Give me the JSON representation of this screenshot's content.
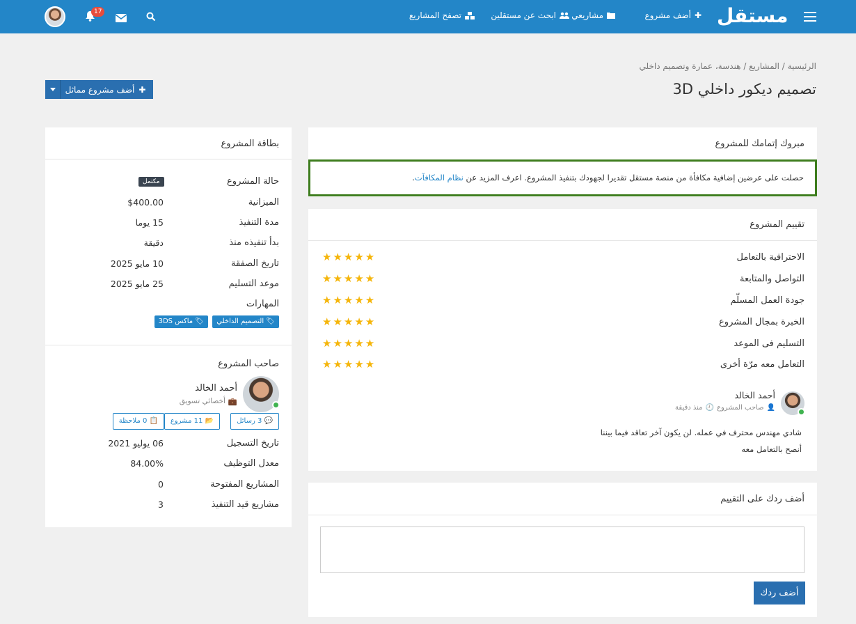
{
  "nav": {
    "logo": "مستقل",
    "items": [
      {
        "label": "أضف مشروع",
        "icon": "plus-icon"
      },
      {
        "label": "مشاريعي",
        "icon": "folder-icon"
      },
      {
        "label": "ابحث عن مستقلين",
        "icon": "users-icon"
      },
      {
        "label": "تصفح المشاريع",
        "icon": "cubes-icon"
      }
    ],
    "notification_count": "17"
  },
  "breadcrumb": "الرئيسية / المشاريع / هندسة، عمارة وتصميم داخلي",
  "page_title": "تصميم ديكور داخلي 3D",
  "similar_button": "أضف مشروع مماثل",
  "congrats": {
    "title": "مبروك إتمامك للمشروع",
    "text": "حصلت على عرضين إضافية مكافأة من منصة مستقل تقديرا لجهودك بتنفيذ المشروع. اعرف المزيد عن",
    "link": "نظام المكافآت",
    "end": "."
  },
  "rating": {
    "title": "تقييم المشروع",
    "items": [
      {
        "label": "الاحترافية بالتعامل",
        "stars": 5
      },
      {
        "label": "التواصل والمتابعة",
        "stars": 5
      },
      {
        "label": "جودة العمل المسلّم",
        "stars": 5
      },
      {
        "label": "الخبرة بمجال المشروع",
        "stars": 5
      },
      {
        "label": "التسليم فى الموعد",
        "stars": 5
      },
      {
        "label": "التعامل معه مرّة أخرى",
        "stars": 5
      }
    ],
    "reviewer": {
      "name": "أحمد الخالد",
      "role": "صاحب المشروع",
      "time": "منذ دقيقة",
      "comment_line1": "شادي مهندس محترف في عمله. لن يكون آخر تعاقد فيما بيننا",
      "comment_line2": "أنصح بالتعامل معه"
    }
  },
  "reply": {
    "title": "أضف ردك على التقييم",
    "textarea_value": "",
    "button": "أضف ردك"
  },
  "project_card": {
    "title": "بطاقة المشروع",
    "rows": [
      {
        "label": "حالة المشروع",
        "value": "مكتمل"
      },
      {
        "label": "الميزانية",
        "value": "$400.00"
      },
      {
        "label": "مدة التنفيذ",
        "value": "15 يوما"
      },
      {
        "label": "بدأ تنفيذه منذ",
        "value": "دقيقة"
      },
      {
        "label": "تاريخ الصفقة",
        "value": "10 مايو 2025"
      },
      {
        "label": "موعد التسليم",
        "value": "25 مايو 2025"
      }
    ],
    "skills_label": "المهارات",
    "skills": [
      "التصميم الداخلي",
      "ماكس 3DS"
    ]
  },
  "owner": {
    "title": "صاحب المشروع",
    "name": "أحمد الخالد",
    "job": "أخصائي تسويق",
    "buttons": [
      "3 رسائل",
      "11 مشروع",
      "0 ملاحظة"
    ],
    "rows": [
      {
        "label": "تاريخ التسجيل",
        "value": "06 يوليو 2021"
      },
      {
        "label": "معدل التوظيف",
        "value": "84.00%"
      },
      {
        "label": "المشاريع المفتوحة",
        "value": "0"
      },
      {
        "label": "مشاريع قيد التنفيذ",
        "value": "3"
      }
    ]
  },
  "colors": {
    "primary": "#2386c8",
    "success_border": "#3e7d1e",
    "star": "#f5b50a"
  }
}
